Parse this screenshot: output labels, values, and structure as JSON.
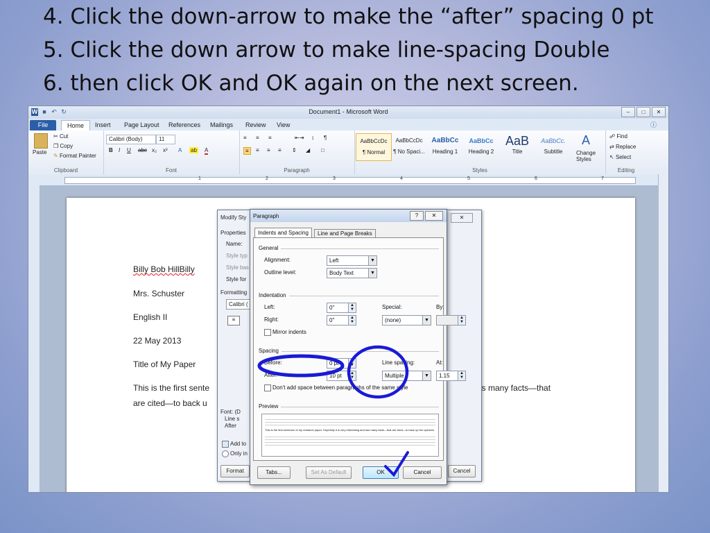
{
  "slide": {
    "lines": [
      "4. Click the down-arrow to make the “after” spacing 0 pt",
      "5. Click the down arrow to make line-spacing Double",
      "6. then click OK and OK again on the next screen."
    ]
  },
  "word": {
    "title": "Document1 - Microsoft Word",
    "quick_access": [
      "W",
      "■",
      "↶",
      "↻"
    ],
    "window_controls": [
      "–",
      "□",
      "✕"
    ],
    "tabs": [
      "File",
      "Home",
      "Insert",
      "Page Layout",
      "References",
      "Mailings",
      "Review",
      "View"
    ],
    "clipboard": {
      "paste": "Paste",
      "cut": "Cut",
      "copy": "Copy",
      "format_painter": "Format Painter",
      "label": "Clipboard"
    },
    "font": {
      "name": "Calibri (Body)",
      "size": "11",
      "label": "Font",
      "buttons": [
        "B",
        "I",
        "U",
        "abc",
        "x₂",
        "x²",
        "A",
        "A"
      ]
    },
    "paragraph": {
      "label": "Paragraph"
    },
    "styles": {
      "label": "Styles",
      "items": [
        {
          "preview": "AaBbCcDc",
          "name": "¶ Normal"
        },
        {
          "preview": "AaBbCcDc",
          "name": "¶ No Spaci..."
        },
        {
          "preview": "AaBbCc",
          "name": "Heading 1"
        },
        {
          "preview": "AaBbCc",
          "name": "Heading 2"
        },
        {
          "preview": "AaB",
          "name": "Title"
        },
        {
          "preview": "AaBbCc.",
          "name": "Subtitle"
        }
      ],
      "change_styles": "Change Styles"
    },
    "editing": {
      "label": "Editing",
      "find": "Find",
      "replace": "Replace",
      "select": "Select"
    },
    "ruler_marks": [
      "1",
      "2",
      "3",
      "4",
      "5",
      "6",
      "7"
    ],
    "document": {
      "lines": [
        "Billy Bob HillBilly",
        "Mrs. Schuster",
        "English II",
        "22 May 2013",
        "Title of My Paper"
      ],
      "body_left": "This is the first sente",
      "body_right": "as many facts—that",
      "body_line2": "are cited—to back u"
    }
  },
  "modify_dialog": {
    "title": "Modify Sty",
    "properties": "Properties",
    "name": "Name:",
    "style_type": "Style typ",
    "style_based": "Style bas",
    "style_for": "Style for",
    "formatting": "Formatting",
    "font_value": "Calibri (",
    "add_to": "Add to",
    "only_in": "Only in",
    "format_btn": "Format",
    "cancel_btn": "Cancel",
    "font_desc": "Font: (D",
    "line_sp": "Line s",
    "after": "After"
  },
  "paragraph_dialog": {
    "title": "Paragraph",
    "help": "?",
    "close": "✕",
    "tab_indents": "Indents and Spacing",
    "tab_breaks": "Line and Page Breaks",
    "general": "General",
    "alignment_label": "Alignment:",
    "alignment_value": "Left",
    "outline_label": "Outline level:",
    "outline_value": "Body Text",
    "indentation": "Indentation",
    "left_label": "Left:",
    "left_value": "0\"",
    "right_label": "Right:",
    "right_value": "0\"",
    "special_label": "Special:",
    "special_value": "(none)",
    "by_label": "By:",
    "mirror": "Mirror indents",
    "spacing": "Spacing",
    "before_label": "Before:",
    "before_value": "0 pt",
    "after_label": "After:",
    "after_value": "10 pt",
    "line_spacing_label": "Line spacing:",
    "line_spacing_value": "Multiple",
    "at_label": "At:",
    "at_value": "1.15",
    "dont_add": "Don't add space between paragraphs of the same style",
    "preview": "Preview",
    "preview_text": "This is the first sentence of my research paper. Hopefully it is very interesting and has many facts—that are cited—to back up the opinions",
    "tabs_btn": "Tabs...",
    "set_default_btn": "Set As Default",
    "ok_btn": "OK",
    "cancel_btn": "Cancel"
  },
  "colors": {
    "annotation": "#1a1ad6",
    "accent": "#2a5ea8"
  }
}
